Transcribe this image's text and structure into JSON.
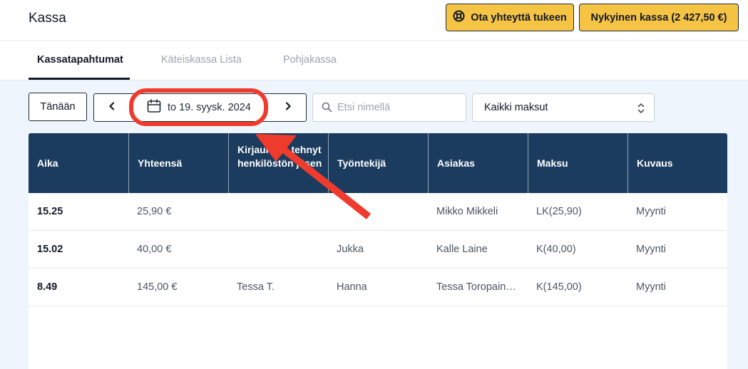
{
  "header": {
    "title": "Kassa",
    "support_label": "Ota yhteyttä tukeen",
    "current_kassa_label": "Nykyinen kassa (2 427,50 €)"
  },
  "tabs": [
    {
      "label": "Kassatapahtumat",
      "active": true
    },
    {
      "label": "Käteiskassa Lista",
      "active": false
    },
    {
      "label": "Pohjakassa",
      "active": false
    }
  ],
  "toolbar": {
    "today_label": "Tänään",
    "date_label": "to 19. syysk. 2024",
    "search_placeholder": "Etsi nimellä",
    "search_value": "",
    "payment_filter": "Kaikki maksut"
  },
  "table": {
    "headers": [
      "Aika",
      "Yhteensä",
      "Kirjauksen tehnyt henkilöstön jäsen",
      "Työntekijä",
      "Asiakas",
      "Maksu",
      "Kuvaus"
    ],
    "rows": [
      {
        "time": "15.25",
        "total": "25,90 €",
        "recorded_by": "",
        "employee": "",
        "customer": "Mikko Mikkeli",
        "payment": "LK(25,90)",
        "description": "Myynti"
      },
      {
        "time": "15.02",
        "total": "40,00 €",
        "recorded_by": "",
        "employee": "Jukka",
        "customer": "Kalle Laine",
        "payment": "K(40,00)",
        "description": "Myynti"
      },
      {
        "time": "8.49",
        "total": "145,00 €",
        "recorded_by": "Tessa T.",
        "employee": "Hanna",
        "customer": "Tessa Toropain…",
        "payment": "K(145,00)",
        "description": "Myynti"
      }
    ]
  },
  "colors": {
    "accent_yellow": "#f6c444",
    "table_header": "#1b3c5e",
    "annotation_red": "#ef3b2d",
    "content_bg": "#eef5fd"
  },
  "icons": {
    "support": "lifebuoy-icon",
    "prev": "chevron-left-icon",
    "next": "chevron-right-icon",
    "date": "calendar-icon",
    "search": "search-icon",
    "select": "chevron-up-down-icon"
  }
}
